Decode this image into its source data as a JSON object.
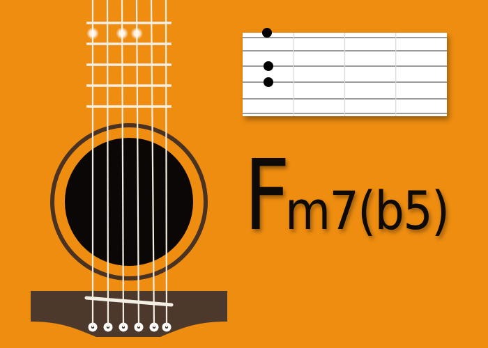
{
  "chord": {
    "root": "F",
    "quality": "m7(b5)"
  },
  "instrument": {
    "strings": 6,
    "neck_frets": 5
  },
  "diagram": {
    "frets": 4,
    "dots": [
      {
        "string": 1,
        "fret": 0
      },
      {
        "string": 3,
        "fret": 1
      },
      {
        "string": 4,
        "fret": 1
      }
    ]
  },
  "neck_highlights": [
    {
      "string": 1,
      "fret": 1
    },
    {
      "string": 3,
      "fret": 1
    },
    {
      "string": 4,
      "fret": 1
    }
  ],
  "colors": {
    "background": "#ee8d10",
    "sound_hole": "#0a0706",
    "ring": "#4a3222",
    "bridge": "#4d392b",
    "string": "#f4efe4",
    "diagram_bg": "#ffffff",
    "diagram_line": "#7a7a7a",
    "dot": "#000000",
    "text": "#0d0a07"
  }
}
